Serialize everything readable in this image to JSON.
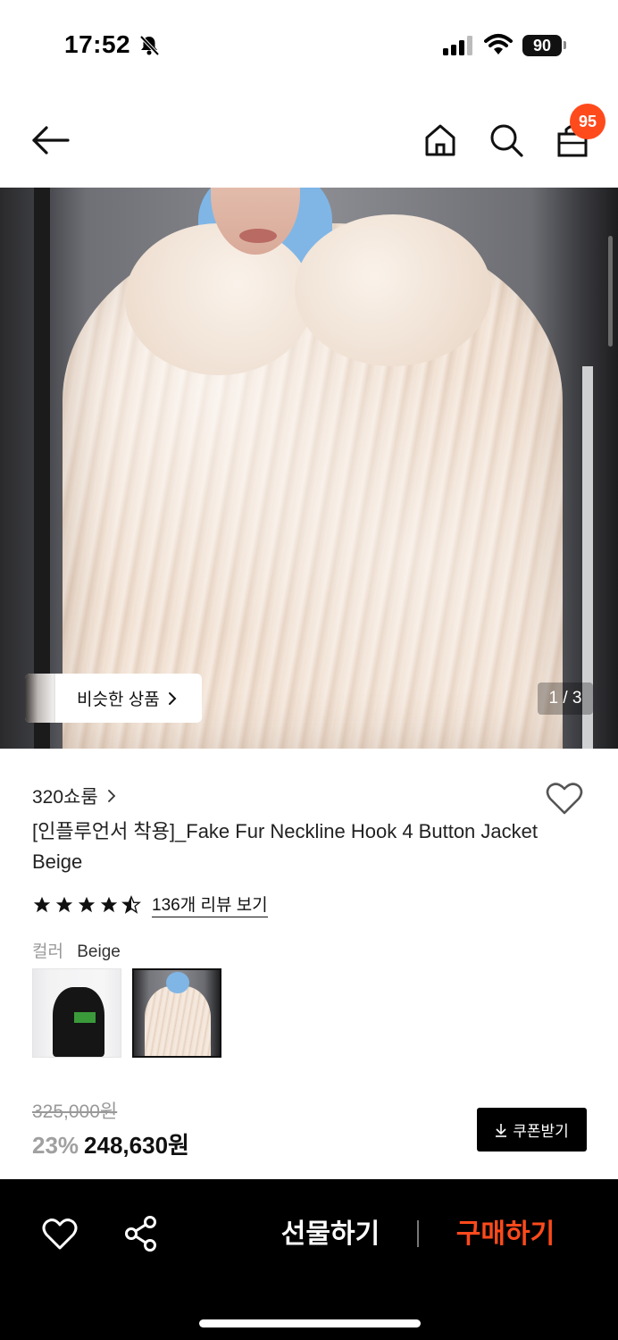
{
  "status_bar": {
    "time": "17:52",
    "battery": "90"
  },
  "header": {
    "cart_count": "95"
  },
  "gallery": {
    "similar_label": "비슷한 상품",
    "page_indicator": "1 / 3"
  },
  "product": {
    "brand": "320쇼룸",
    "title": "[인플루언서 착용]_Fake Fur Neckline Hook 4 Button Jacket Beige",
    "rating": 4.5,
    "review_link": "136개 리뷰 보기",
    "color_label": "컬러",
    "color_value": "Beige",
    "original_price": "325,000원",
    "discount": "23%",
    "sale_price": "248,630원",
    "coupon_label": "쿠폰받기"
  },
  "bottom_bar": {
    "gift_label": "선물하기",
    "buy_label": "구매하기"
  },
  "colors": {
    "accent": "#ff4a1c",
    "bar": "#000000"
  }
}
